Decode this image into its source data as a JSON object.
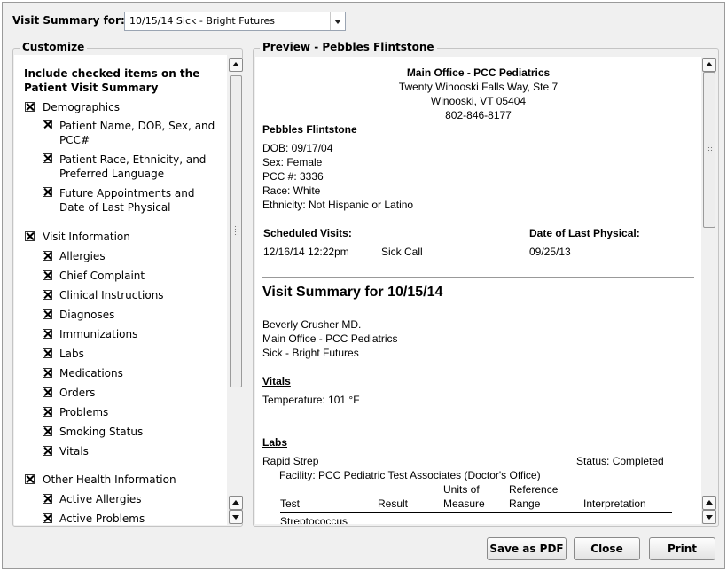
{
  "header": {
    "label": "Visit Summary for:",
    "selected_visit": "10/15/14 Sick - Bright Futures"
  },
  "customize": {
    "title": "Customize",
    "heading": "Include checked items on the Patient Visit Summary",
    "groups": [
      {
        "label": "Demographics",
        "checked": true,
        "items": [
          {
            "label": "Patient Name, DOB, Sex, and PCC#",
            "checked": true
          },
          {
            "label": "Patient Race, Ethnicity, and Preferred Language",
            "checked": true
          },
          {
            "label": "Future Appointments and Date of Last Physical",
            "checked": true
          }
        ]
      },
      {
        "label": "Visit Information",
        "checked": true,
        "items": [
          {
            "label": "Allergies",
            "checked": true
          },
          {
            "label": "Chief Complaint",
            "checked": true
          },
          {
            "label": "Clinical Instructions",
            "checked": true
          },
          {
            "label": "Diagnoses",
            "checked": true
          },
          {
            "label": "Immunizations",
            "checked": true
          },
          {
            "label": "Labs",
            "checked": true
          },
          {
            "label": "Medications",
            "checked": true
          },
          {
            "label": "Orders",
            "checked": true
          },
          {
            "label": "Problems",
            "checked": true
          },
          {
            "label": "Smoking Status",
            "checked": true
          },
          {
            "label": "Vitals",
            "checked": true
          }
        ]
      },
      {
        "label": "Other Health Information",
        "checked": true,
        "items": [
          {
            "label": "Active Allergies",
            "checked": true
          },
          {
            "label": "Active Problems",
            "checked": true
          }
        ]
      }
    ]
  },
  "preview": {
    "title": "Preview - Pebbles Flintstone",
    "office": {
      "name": "Main Office - PCC Pediatrics",
      "address1": "Twenty Winooski Falls Way, Ste 7",
      "address2": "Winooski, VT 05404",
      "phone": "802-846-8177"
    },
    "patient": {
      "name": "Pebbles Flintstone",
      "dob": "DOB: 09/17/04",
      "sex": "Sex: Female",
      "pcc": "PCC #: 3336",
      "race": "Race: White",
      "ethnicity": "Ethnicity: Not Hispanic or Latino"
    },
    "scheduled": {
      "label": "Scheduled Visits:",
      "datetime": "12/16/14 12:22pm",
      "type": "Sick Call"
    },
    "last_physical": {
      "label": "Date of Last Physical:",
      "date": "09/25/13"
    },
    "visit_title": "Visit Summary for 10/15/14",
    "provider": "Beverly Crusher MD.",
    "location": "Main Office - PCC Pediatrics",
    "visit_type": "Sick - Bright Futures",
    "vitals": {
      "heading": "Vitals",
      "temperature": "Temperature: 101 °F"
    },
    "labs": {
      "heading": "Labs",
      "test_name": "Rapid Strep",
      "status": "Status: Completed",
      "facility": "Facility: PCC Pediatric Test Associates (Doctor's Office)",
      "columns": {
        "test": "Test",
        "result": "Result",
        "units_1": "Units of",
        "units_2": "Measure",
        "reference_1": "Reference",
        "reference_2": "Range",
        "interpretation": "Interpretation"
      },
      "first_row": "Streptococcus"
    }
  },
  "buttons": {
    "save_pdf": "Save as PDF",
    "close": "Close",
    "print": "Print"
  }
}
